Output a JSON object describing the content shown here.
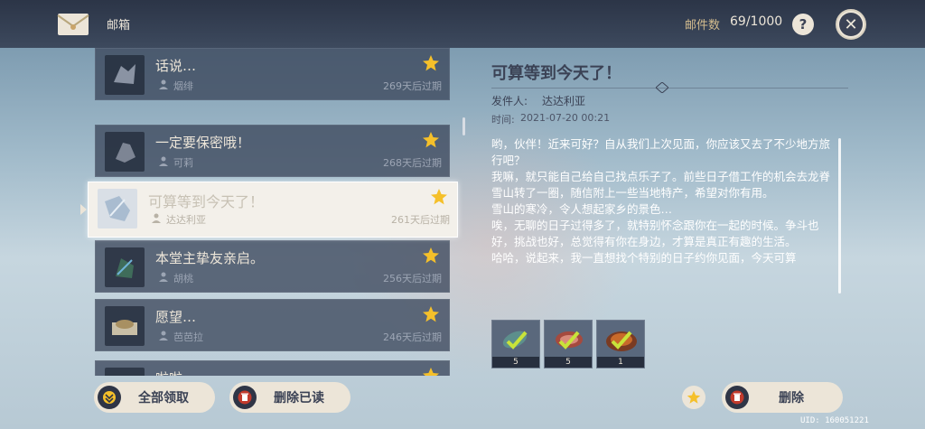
{
  "header": {
    "title": "邮箱",
    "count_label": "邮件数",
    "count_value": "69/1000",
    "help": "?"
  },
  "mail_list": [
    {
      "title": "话说…",
      "sender": "烟绯",
      "expire": "269天后过期",
      "starred": true
    },
    {
      "title": "一定要保密哦！",
      "sender": "可莉",
      "expire": "268天后过期",
      "starred": true
    },
    {
      "title": "可算等到今天了！",
      "sender": "达达利亚",
      "expire": "261天后过期",
      "starred": true,
      "selected": true
    },
    {
      "title": "本堂主挚友亲启。",
      "sender": "胡桃",
      "expire": "256天后过期",
      "starred": true
    },
    {
      "title": "愿望…",
      "sender": "芭芭拉",
      "expire": "246天后过期",
      "starred": true
    },
    {
      "title": "啦啦",
      "sender": "",
      "expire": "",
      "starred": true
    }
  ],
  "detail": {
    "title": "可算等到今天了！",
    "sender_label": "发件人:",
    "sender": "达达利亚",
    "time_label": "时间:",
    "time": "2021-07-20 00:21",
    "body": [
      "哟，伙伴！近来可好？自从我们上次见面，你应该又去了不少地方旅行吧？",
      "我嘛，就只能自己给自己找点乐子了。前些日子借工作的机会去龙脊雪山转了一圈，随信附上一些当地特产，希望对你有用。",
      "雪山的寒冷，令人想起家乡的景色…",
      "唉，无聊的日子过得多了，就特别怀念跟你在一起的时候。争斗也好，挑战也好，总觉得有你在身边，才算是真正有趣的生活。",
      "哈哈，说起来，我一直想找个特别的日子约你见面，今天可算"
    ],
    "attachments": [
      {
        "name": "fish-icon",
        "qty": "5"
      },
      {
        "name": "meat-icon",
        "qty": "5"
      },
      {
        "name": "dish-icon",
        "qty": "1"
      }
    ]
  },
  "footer": {
    "claim_all": "全部领取",
    "delete_read": "删除已读",
    "delete": "删除",
    "uid": "UID: 160051221"
  },
  "colors": {
    "header_bg": "#2c3446",
    "button_bg": "#ece5d8",
    "text_dark": "#3b4255",
    "star_gold": "#f5c02a",
    "delete_red": "#c23a2c"
  }
}
